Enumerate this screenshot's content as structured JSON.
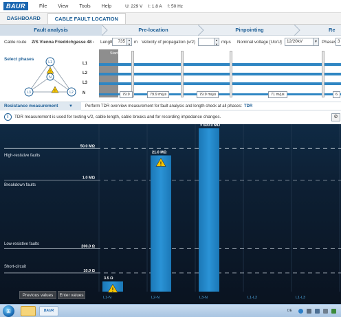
{
  "menubar": {
    "logo_text": "BAUR",
    "items": [
      "File",
      "View",
      "Tools",
      "Help"
    ],
    "readouts": [
      "U: 229 V",
      "I: 1.8 A",
      "f: 50 Hz"
    ]
  },
  "tabs": [
    {
      "label": "DASHBOARD",
      "active": false
    },
    {
      "label": "CABLE FAULT LOCATION",
      "active": true
    }
  ],
  "steps": [
    {
      "label": "Fault analysis",
      "active": true
    },
    {
      "label": "Pre-location",
      "active": false
    },
    {
      "label": "Pinpointing",
      "active": false
    },
    {
      "label": "Re",
      "active": false
    }
  ],
  "params": {
    "cable_route_label": "Cable route",
    "cable_route_value": "Z/S Vienna Friedrichgasse 48 -",
    "length_label": "Length",
    "length_value": "735",
    "length_unit": "m",
    "velocity_label": "Velocity of propagation  (v/2)",
    "velocity_value": "",
    "velocity_unit": "m/μs",
    "voltage_label": "Nominal voltage [Uo/U]",
    "voltage_value": "12/20kV",
    "phases_label": "Phases",
    "phases_value": "3"
  },
  "phase_panel": {
    "select_label": "Select phases",
    "phase_nodes": [
      "L1",
      "L2",
      "L3",
      "N"
    ],
    "line_labels": [
      "L1",
      "L2",
      "L3",
      "N"
    ],
    "start_label": "Start",
    "velocities": [
      "79.9",
      "79.9 m/μs",
      "79.9 m/μs",
      "71 m/μs",
      "6"
    ]
  },
  "measurement": {
    "selected": "Resistance measurement",
    "description": "Perform TDR overview measurement for fault analysis and length check at all phases:",
    "link": "TDR"
  },
  "info": {
    "icon": "info-icon",
    "text": "TDR measurement is used for testing v/2, cable length, cable breaks and for recording impedance changes.",
    "settings_icon": "gear-icon"
  },
  "chart_data": {
    "type": "bar",
    "scale": "log",
    "ylim": [
      "1.0 Ω",
      "1.0 GΩ"
    ],
    "categories": [
      "L1-N",
      "L2-N",
      "L3-N",
      "L1-L2",
      "L1-L3"
    ],
    "values_ohm": [
      3.5,
      21000000,
      600000000,
      null,
      null
    ],
    "value_labels": [
      "3.5 Ω",
      "21.0 MΩ",
      "> 600.0 MΩ",
      "",
      ""
    ],
    "warnings": [
      true,
      true,
      false,
      false,
      false
    ],
    "threshold_labels": [
      "50.0 MΩ",
      "1.0 MΩ",
      "200.0 Ω",
      "10.0 Ω"
    ],
    "threshold_values_ohm": [
      50000000,
      1000000,
      200,
      10
    ],
    "zones": [
      "High-resistive faults",
      "Breakdown faults",
      "Low-resistive faults",
      "Short-circuit"
    ],
    "grid": true
  },
  "bottom_buttons": [
    "Previous values",
    "Enter values"
  ],
  "taskbar": {
    "app_label": "BAUR",
    "tray_text": "DE"
  },
  "colors": {
    "brand": "#1a66b0",
    "bar": "#1f86c8",
    "chart_bg": "#0c1826",
    "warning": "#f5c400"
  }
}
